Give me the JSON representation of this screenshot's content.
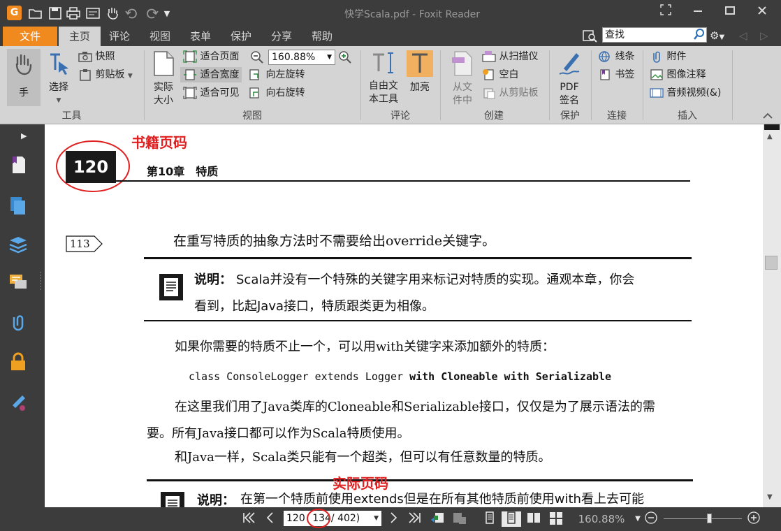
{
  "app": {
    "logo_letter": "G",
    "window_title": "快学Scala.pdf - Foxit Reader",
    "quick_access": [
      "open",
      "save",
      "print",
      "properties",
      "hand-tool",
      "undo",
      "redo",
      "customize"
    ],
    "window_controls": [
      "restore-down",
      "minimize",
      "maximize",
      "close"
    ]
  },
  "tabs": [
    {
      "label": "文件"
    },
    {
      "label": "主页"
    },
    {
      "label": "评论"
    },
    {
      "label": "视图"
    },
    {
      "label": "表单"
    },
    {
      "label": "保护"
    },
    {
      "label": "分享"
    },
    {
      "label": "帮助"
    }
  ],
  "search": {
    "value": "查找"
  },
  "ribbon": {
    "tools": {
      "hand": "手",
      "select": "选择",
      "snapshot": "快照",
      "clipboard": "剪贴板",
      "group_label": "工具"
    },
    "view": {
      "actual_size": [
        "实际",
        "大小"
      ],
      "fit_page": "适合页面",
      "fit_width": "适合宽度",
      "fit_visible": "适合可见",
      "zoom_value": "160.88%",
      "rotate_left": "向左旋转",
      "rotate_right": "向右旋转",
      "group_label": "视图"
    },
    "comment": {
      "typewriter": [
        "自由文",
        "本工具"
      ],
      "highlight": "加亮",
      "group_label": "评论"
    },
    "create": {
      "from_file": [
        "从文",
        "件中"
      ],
      "from_scanner": "从扫描仪",
      "blank": "空白",
      "from_clipboard": "从剪贴板",
      "group_label": "创建"
    },
    "protect": {
      "pdf_sign": [
        "PDF",
        "签名"
      ],
      "group_label": "保护"
    },
    "links": {
      "link": "线条",
      "bookmark": "书签",
      "group_label": "连接"
    },
    "insert": {
      "attachment": "附件",
      "image_annotation": "图像注释",
      "audio_video": "音频视频(&)",
      "group_label": "插入"
    }
  },
  "document": {
    "annotation_book_page": "书籍页码",
    "annotation_actual_page": "实际页码",
    "page_number": "120",
    "chapter_header": "第10章　特质",
    "margin_ref": "113",
    "line1": "在重写特质的抽象方法时不需要给出override关键字。",
    "note1_label": "说明：",
    "note1_line1": "Scala并没有一个特殊的关键字用来标记对特质的实现。通观本章，你会",
    "note1_line2": "看到，比起Java接口，特质跟类更为相像。",
    "para2": "如果你需要的特质不止一个，可以用with关键字来添加额外的特质：",
    "code_plain": "class ConsoleLogger extends Logger ",
    "code_bold": "with Cloneable with Serializable",
    "para3_line1": "在这里我们用了Java类库的Cloneable和Serializable接口，仅仅是为了展示语法的需",
    "para3_line2": "要。所有Java接口都可以作为Scala特质使用。",
    "para4": "和Java一样，Scala类只能有一个超类，但可以有任意数量的特质。",
    "note2_label": "说明：",
    "note2_line1": "在第一个特质前使用extends但是在所有其他特质前使用with看上去可能"
  },
  "statusbar": {
    "page_current": "120",
    "page_actual": "134",
    "page_total": "/ 402)",
    "zoom": "160.88%"
  },
  "colors": {
    "accent_orange": "#f08a1f",
    "annotation_red": "#e02020",
    "chrome_dark": "#3c3c3c",
    "ribbon_gray": "#d4d4d4"
  }
}
